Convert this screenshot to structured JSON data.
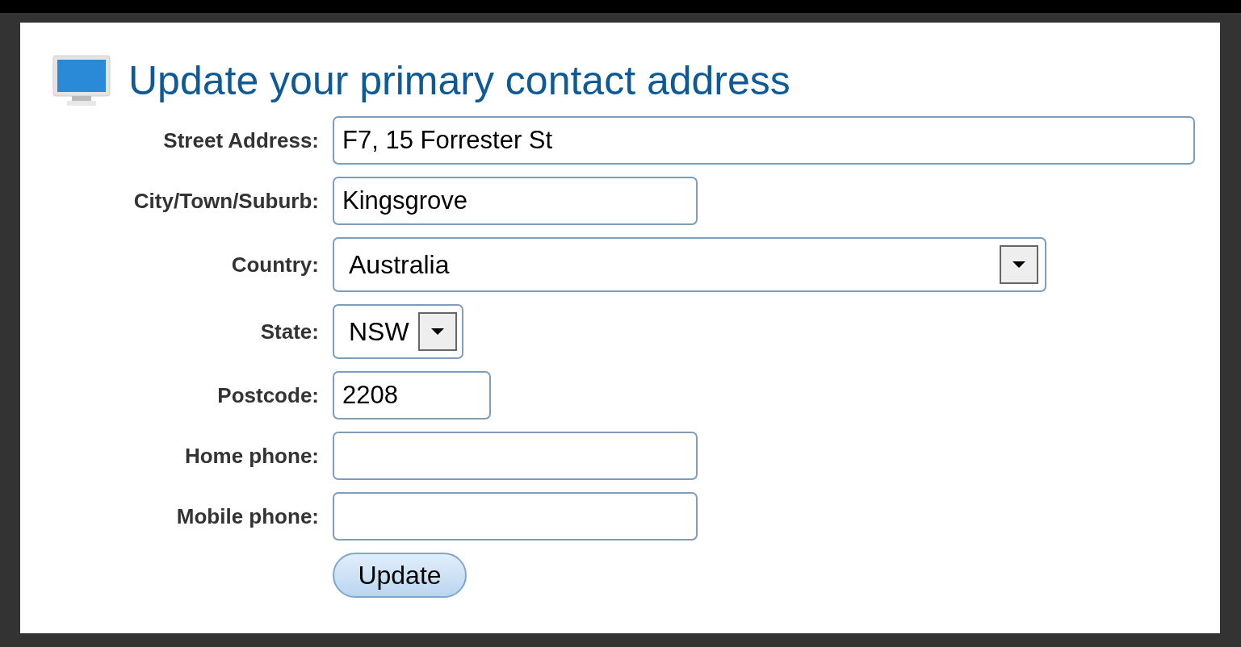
{
  "title": "Update your primary contact address",
  "fields": [
    {
      "label": "Street Address:",
      "kind": "text",
      "value": "F7, 15 Forrester St"
    },
    {
      "label": "City/Town/Suburb:",
      "kind": "text",
      "value": "Kingsgrove"
    },
    {
      "label": "Country:",
      "kind": "select",
      "value": "Australia"
    },
    {
      "label": "State:",
      "kind": "select",
      "value": "NSW"
    },
    {
      "label": "Postcode:",
      "kind": "text",
      "value": "2208"
    },
    {
      "label": "Home phone:",
      "kind": "text"
    },
    {
      "label": "Mobile phone:",
      "kind": "text"
    }
  ],
  "button": "Update"
}
